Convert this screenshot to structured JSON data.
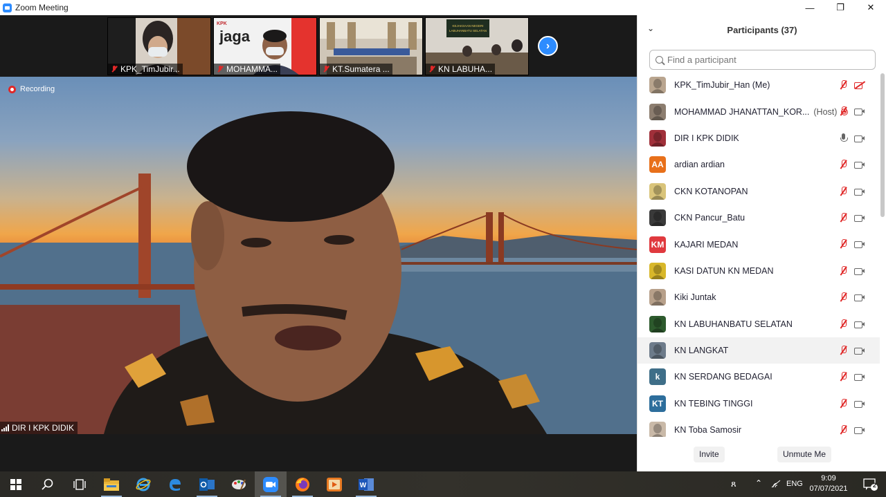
{
  "window": {
    "title": "Zoom Meeting",
    "controls": [
      "—",
      "❐",
      "✕"
    ]
  },
  "thumbnails": [
    {
      "label": "KPK_TimJubir..."
    },
    {
      "label": "MOHAMMA...",
      "brand_small": "KPK",
      "brand": "jaga"
    },
    {
      "label": "KT.Sumatera ..."
    },
    {
      "label": "KN LABUHA...",
      "banner_lines": [
        "KEJAKSAAN NEGERI",
        "LABUHANBATU SELATAN"
      ]
    }
  ],
  "main_video": {
    "recording_label": "Recording",
    "speaker_label": "DIR I KPK DIDIK"
  },
  "participants": {
    "title": "Participants (37)",
    "search_placeholder": "Find a participant",
    "list": [
      {
        "name": "KPK_TimJubir_Han (Me)",
        "avatar_type": "photo",
        "avatar_color": "#b9a58f",
        "mic": "muted",
        "cam": "off"
      },
      {
        "name": "MOHAMMAD JHANATTAN_KOR...",
        "host": "(Host)",
        "recording": true,
        "avatar_type": "photo",
        "avatar_color": "#8c7d6f",
        "mic": "muted",
        "cam": "on"
      },
      {
        "name": "DIR I KPK DIDIK",
        "avatar_type": "photo",
        "avatar_color": "#a0303a",
        "mic": "on",
        "cam": "on"
      },
      {
        "name": "ardian ardian",
        "avatar_type": "initials",
        "initials": "AA",
        "avatar_color": "#e8701a",
        "mic": "muted",
        "cam": "on"
      },
      {
        "name": "CKN KOTANOPAN",
        "avatar_type": "photo",
        "avatar_color": "#d9c47a",
        "mic": "muted",
        "cam": "on"
      },
      {
        "name": "CKN Pancur_Batu",
        "avatar_type": "photo",
        "avatar_color": "#3a3a3a",
        "mic": "muted",
        "cam": "on"
      },
      {
        "name": "KAJARI MEDAN",
        "avatar_type": "initials",
        "initials": "KM",
        "avatar_color": "#e0393e",
        "mic": "muted",
        "cam": "on"
      },
      {
        "name": "KASI DATUN KN MEDAN",
        "avatar_type": "photo",
        "avatar_color": "#d8b72a",
        "mic": "muted",
        "cam": "on"
      },
      {
        "name": "Kiki Juntak",
        "avatar_type": "photo",
        "avatar_color": "#b7a08a",
        "mic": "muted",
        "cam": "on"
      },
      {
        "name": "KN LABUHANBATU SELATAN",
        "avatar_type": "photo",
        "avatar_color": "#2d5a2d",
        "mic": "muted",
        "cam": "on"
      },
      {
        "name": "KN LANGKAT",
        "avatar_type": "photo",
        "avatar_color": "#6d7b8a",
        "mic": "muted",
        "cam": "on",
        "highlight": true
      },
      {
        "name": "KN SERDANG BEDAGAI",
        "avatar_type": "initials",
        "initials": "k",
        "avatar_color": "#3e6e88",
        "mic": "muted",
        "cam": "on"
      },
      {
        "name": "KN TEBING TINGGI",
        "avatar_type": "initials",
        "initials": "KT",
        "avatar_color": "#2d6e9c",
        "mic": "muted",
        "cam": "on"
      },
      {
        "name": "KN Toba Samosir",
        "avatar_type": "photo",
        "avatar_color": "#c9b9a8",
        "mic": "muted",
        "cam": "on"
      }
    ],
    "invite_label": "Invite",
    "unmute_label": "Unmute Me"
  },
  "taskbar": {
    "language": "ENG",
    "time": "9:09",
    "date": "07/07/2021",
    "notification_count": "2"
  }
}
